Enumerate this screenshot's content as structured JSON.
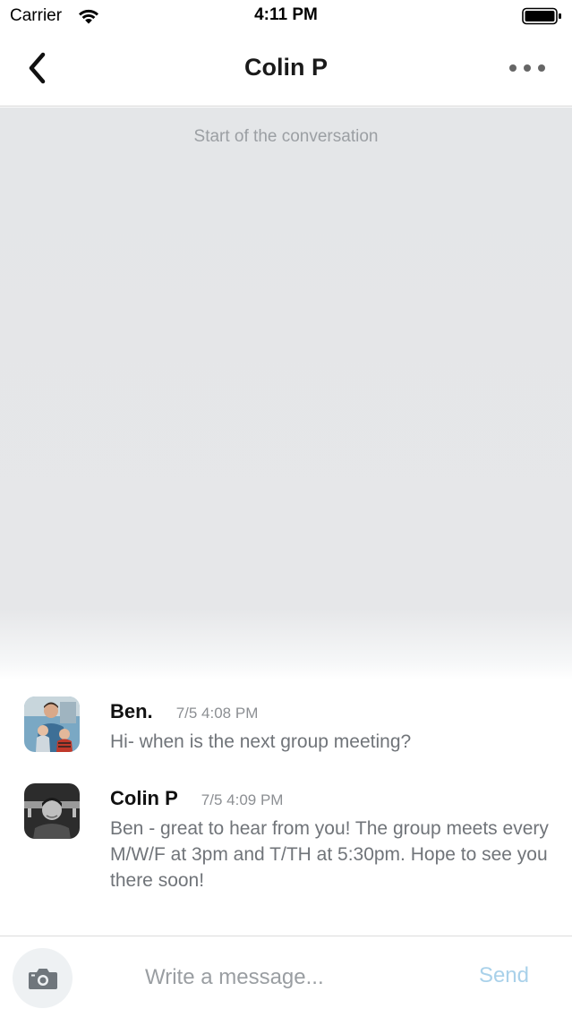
{
  "status_bar": {
    "carrier": "Carrier",
    "time": "4:11 PM",
    "wifi_icon": "wifi-icon",
    "battery_icon": "battery-icon"
  },
  "nav": {
    "title": "Colin P",
    "back_icon": "chevron-left-icon",
    "more_icon": "more-horizontal-icon"
  },
  "conversation": {
    "start_label": "Start of the conversation",
    "messages": [
      {
        "sender": "Ben.",
        "timestamp": "7/5 4:08 PM",
        "text": "Hi- when is the next group meeting?",
        "avatar": "avatar-ben"
      },
      {
        "sender": "Colin P",
        "timestamp": "7/5 4:09 PM",
        "text": "Ben - great to hear from you! The group meets every M/W/F at 3pm and T/TH at 5:30pm. Hope to see you there soon!",
        "avatar": "avatar-colin"
      }
    ]
  },
  "composer": {
    "camera_icon": "camera-icon",
    "placeholder": "Write a message...",
    "value": "",
    "send_label": "Send"
  },
  "colors": {
    "send_disabled": "#a9d1ea",
    "background_gray": "#e5e7e9",
    "text_gray": "#707479"
  }
}
